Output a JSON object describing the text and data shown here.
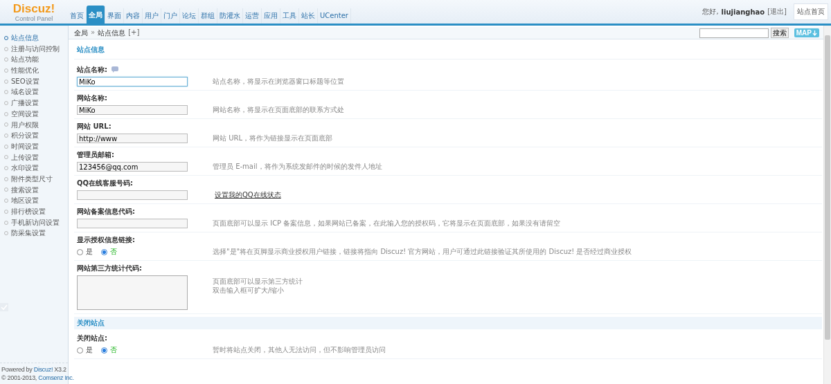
{
  "logo": {
    "brand": "Discuz!",
    "subtitle": "Control Panel"
  },
  "nav": [
    {
      "label": "首页",
      "selected": false
    },
    {
      "label": "全局",
      "selected": true
    },
    {
      "label": "界面",
      "selected": false
    },
    {
      "label": "内容",
      "selected": false
    },
    {
      "label": "用户",
      "selected": false
    },
    {
      "label": "门户",
      "selected": false
    },
    {
      "label": "论坛",
      "selected": false
    },
    {
      "label": "群组",
      "selected": false
    },
    {
      "label": "防灌水",
      "selected": false
    },
    {
      "label": "运营",
      "selected": false
    },
    {
      "label": "应用",
      "selected": false
    },
    {
      "label": "工具",
      "selected": false
    },
    {
      "label": "站长",
      "selected": false
    },
    {
      "label": "UCenter",
      "selected": false
    }
  ],
  "user": {
    "greeting": "您好,",
    "name": "liujianghao",
    "logout": "[退出]",
    "home_button": "站点首页"
  },
  "breadcrumb": {
    "root": "全局",
    "separator": "»",
    "current": "站点信息",
    "add": "[+]"
  },
  "search": {
    "button": "搜索",
    "map": "MAP"
  },
  "sidebar": {
    "items": [
      {
        "label": "站点信息",
        "selected": true
      },
      {
        "label": "注册与访问控制",
        "selected": false
      },
      {
        "label": "站点功能",
        "selected": false
      },
      {
        "label": "性能优化",
        "selected": false
      },
      {
        "label": "SEO设置",
        "selected": false
      },
      {
        "label": "域名设置",
        "selected": false
      },
      {
        "label": "广播设置",
        "selected": false
      },
      {
        "label": "空间设置",
        "selected": false
      },
      {
        "label": "用户权限",
        "selected": false
      },
      {
        "label": "积分设置",
        "selected": false
      },
      {
        "label": "时间设置",
        "selected": false
      },
      {
        "label": "上传设置",
        "selected": false
      },
      {
        "label": "水印设置",
        "selected": false
      },
      {
        "label": "附件类型尺寸",
        "selected": false
      },
      {
        "label": "搜索设置",
        "selected": false
      },
      {
        "label": "地区设置",
        "selected": false
      },
      {
        "label": "排行榜设置",
        "selected": false
      },
      {
        "label": "手机新访问设置",
        "selected": false
      },
      {
        "label": "防采集设置",
        "selected": false
      }
    ],
    "footer": {
      "powered": "Powered by",
      "product": "Discuz!",
      "version": "X3.2",
      "copyright": "© 2001-2013,",
      "company": "Comsenz Inc."
    }
  },
  "sections": [
    {
      "title": "站点信息",
      "settings": [
        {
          "kind": "text",
          "label": "站点名称:",
          "help": true,
          "value": "MiKo",
          "focused": true,
          "hint": "站点名称，将显示在浏览器窗口标题等位置"
        },
        {
          "kind": "text",
          "label": "网站名称:",
          "help": false,
          "value": "MiKo",
          "focused": false,
          "hint": "网站名称，将显示在页面底部的联系方式处"
        },
        {
          "kind": "text",
          "label": "网站 URL:",
          "help": false,
          "value": "http://www",
          "focused": false,
          "hint": "网站 URL，将作为链接显示在页面底部"
        },
        {
          "kind": "text",
          "label": "管理员邮箱:",
          "help": false,
          "value": "123456@qq.com",
          "focused": false,
          "hint": "管理员 E-mail，将作为系统发邮件的时候的发件人地址"
        },
        {
          "kind": "link",
          "label": "QQ在线客服号码:",
          "help": false,
          "focused": false,
          "link": "设置我的QQ在线状态"
        },
        {
          "kind": "text",
          "label": "网站备案信息代码:",
          "help": false,
          "focused": false,
          "hint": "页面底部可以显示 ICP 备案信息，如果网站已备案，在此输入您的授权码，它将显示在页面底部，如果没有请留空"
        },
        {
          "kind": "radio",
          "label": "显示授权信息链接:",
          "help": false,
          "options": [
            {
              "label": "是",
              "selected": false
            },
            {
              "label": "否",
              "selected": true
            }
          ],
          "hint": "选择\"是\"将在页脚显示商业授权用户链接，链接将指向 Discuz! 官方网站，用户可通过此链接验证其所使用的 Discuz! 是否经过商业授权"
        },
        {
          "kind": "textarea",
          "label": "网站第三方统计代码:",
          "help": false,
          "hint_lines": [
            "页面底部可以显示第三方统计",
            "双击输入框可扩大/缩小"
          ]
        }
      ]
    },
    {
      "title": "关闭站点",
      "settings": [
        {
          "kind": "radio",
          "label": "关闭站点:",
          "help": false,
          "options": [
            {
              "label": "是",
              "selected": false
            },
            {
              "label": "否",
              "selected": true
            }
          ],
          "hint": "暂时将站点关闭，其他人无法访问，但不影响管理员访问"
        }
      ]
    }
  ]
}
